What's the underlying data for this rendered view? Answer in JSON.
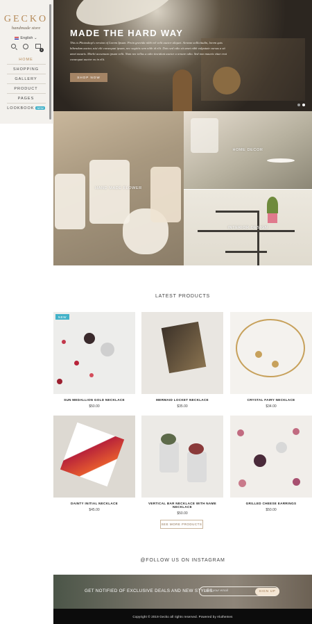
{
  "sidebar": {
    "logo": "GECKO",
    "tagline": "handmade store",
    "language": "English",
    "cart_count": "0",
    "nav": [
      {
        "label": "HOME",
        "active": true
      },
      {
        "label": "SHOPPING"
      },
      {
        "label": "GALLERY"
      },
      {
        "label": "PRODUCT"
      },
      {
        "label": "PAGES"
      },
      {
        "label": "LOOKBOOK",
        "badge": "NEW"
      }
    ]
  },
  "hero": {
    "title": "MADE THE HARD WAY",
    "text": "This is Photoshop's version of Lorem Ipsum. Proin gravida nibh vel velit auctor aliquet. Aenean sollicitudin, lorem quis bibendum auctor, nisi elit consequat ipsum, nec sagittis sem nibh id elit. Duis sed odio sit amet nibh vulputate cursus a sit amet mauris. Morbi accumsan ipsum velit. Nam nec tellus a odio tincidunt auctor a ornare odio. Sed non mauris vitae erat consequat auctor eu in elit.",
    "button": "SHOP NOW"
  },
  "categories": [
    {
      "label": "HAND MADE FLOWER"
    },
    {
      "label": "HOME DECOR"
    },
    {
      "label": "INTERIOR DESIGN"
    }
  ],
  "latest": {
    "title": "LATEST PRODUCTS",
    "see_more": "SEE MORE PRODUCTS",
    "products": [
      {
        "name": "SUN MEDALLION GOLD NECKLACE",
        "price": "$50.00",
        "badge": "NEW"
      },
      {
        "name": "MERMAID LOCKET NECKLACE",
        "price": "$35.00"
      },
      {
        "name": "CRYSTAL FAIRY NECKLACE",
        "price": "$34.00"
      },
      {
        "name": "DAINTY INITIAL NECKLACE",
        "price": "$45.00"
      },
      {
        "name": "VERTICAL BAR NECKLACE WITH NAME NECKLACE",
        "price": "$50.00"
      },
      {
        "name": "GRILLED CHEESE EARRINGS",
        "price": "$50.00"
      }
    ]
  },
  "instagram": {
    "title": "@FOLLOW US ON INSTAGRAM"
  },
  "newsletter": {
    "text": "GET NOTIFIED OF EXCLUSIVE DEALS AND NEW STYLES",
    "placeholder": "Enter your email",
    "button": "SIGN UP"
  },
  "footer": {
    "copyright": "Copyright © 2019 Gecko all rights reserved. Powered by Aluthemes"
  }
}
